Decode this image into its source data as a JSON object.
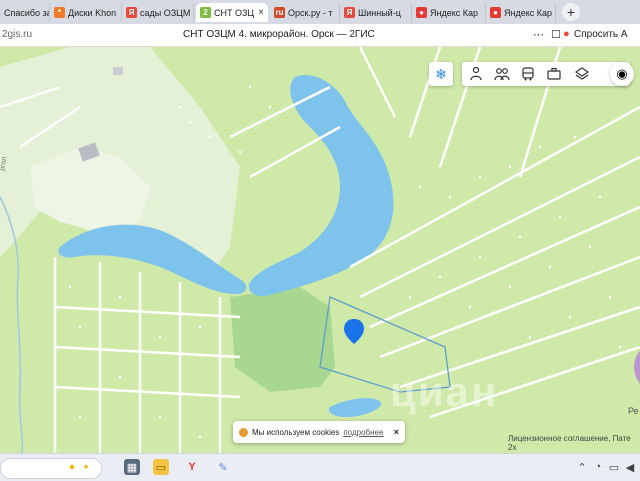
{
  "tabs": [
    {
      "label": "Спасибо за",
      "icon": "",
      "color": "#ffffff",
      "active": false
    },
    {
      "label": "Диски Khon",
      "icon": "*",
      "color": "#f07b2a",
      "active": false
    },
    {
      "label": "сады ОЗЦМ",
      "icon": "Я",
      "color": "#e84b3c",
      "active": false
    },
    {
      "label": "СНТ ОЗЦ",
      "icon": "2",
      "color": "#7fbf3f",
      "active": true
    },
    {
      "label": "Орск.ру - т",
      "icon": "ru",
      "color": "#d64a2a",
      "active": false
    },
    {
      "label": "Шинный-ц",
      "icon": "Я",
      "color": "#e84b3c",
      "active": false
    },
    {
      "label": "Яндекс Кар",
      "icon": "●",
      "color": "#e53935",
      "active": false
    },
    {
      "label": "Яндекс Кар",
      "icon": "●",
      "color": "#e53935",
      "active": false
    }
  ],
  "tab_close": "×",
  "new_tab": "+",
  "address": {
    "url": "2gis.ru",
    "page_title": "СНТ ОЗЦМ 4. микрорайон. Орск — 2ГИС",
    "ask_label": "Спросить А"
  },
  "map": {
    "road_label": "ргол",
    "pe_label": "Ре",
    "watermark": "циан",
    "license_text": "Лицензионное соглашение, Пате 2x"
  },
  "cookie": {
    "text": "Мы используем cookies",
    "more": "подробнее",
    "close": "×"
  },
  "toolbar_icons": [
    "person-icon",
    "people-icon",
    "bus-icon",
    "briefcase-icon",
    "layers-icon"
  ],
  "colors": {
    "water": "#7ec3ec",
    "grass": "#cfe9a8",
    "park": "#e4f1d6",
    "forest": "#a8d890",
    "marker": "#1a73e8"
  }
}
